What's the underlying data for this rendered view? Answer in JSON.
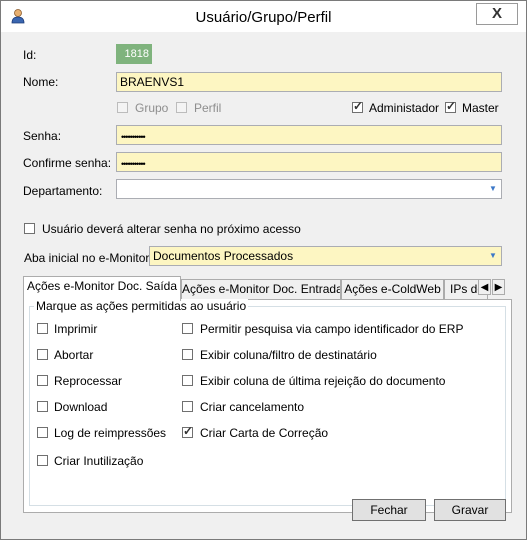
{
  "window": {
    "title": "Usuário/Grupo/Perfil",
    "close_label": "X"
  },
  "form": {
    "id_label": "Id:",
    "id_value": "1818",
    "nome_label": "Nome:",
    "nome_value": "BRAENVS1",
    "grupo_label": "Grupo",
    "perfil_label": "Perfil",
    "admin_label": "Administador",
    "master_label": "Master",
    "senha_label": "Senha:",
    "senha_value": "•••••••••••",
    "confirme_label": "Confirme senha:",
    "confirme_value": "•••••••••••",
    "departamento_label": "Departamento:",
    "departamento_value": "",
    "alterar_senha_label": "Usuário deverá alterar senha no próximo acesso",
    "aba_label": "Aba inicial no e-Monitor:",
    "aba_value": "Documentos Processados"
  },
  "tabs": [
    {
      "label": "Ações e-Monitor Doc. Saída"
    },
    {
      "label": "Ações e-Monitor Doc. Entrada"
    },
    {
      "label": "Ações e-ColdWeb"
    },
    {
      "label": "IPs de"
    }
  ],
  "panel": {
    "legend": "Marque as ações permitidas ao usuário",
    "left_actions": [
      {
        "label": "Imprimir",
        "checked": false
      },
      {
        "label": "Abortar",
        "checked": false
      },
      {
        "label": "Reprocessar",
        "checked": false
      },
      {
        "label": "Download",
        "checked": false
      },
      {
        "label": "Log de reimpressões",
        "checked": false
      },
      {
        "label": "Criar Inutilização",
        "checked": false
      }
    ],
    "right_actions": [
      {
        "label": "Permitir pesquisa via campo identificador do ERP",
        "checked": false
      },
      {
        "label": "Exibir coluna/filtro de destinatário",
        "checked": false
      },
      {
        "label": "Exibir coluna de última rejeição do documento",
        "checked": false
      },
      {
        "label": "Criar cancelamento",
        "checked": false
      },
      {
        "label": "Criar Carta de Correção",
        "checked": true
      }
    ]
  },
  "buttons": {
    "fechar": "Fechar",
    "gravar": "Gravar"
  }
}
